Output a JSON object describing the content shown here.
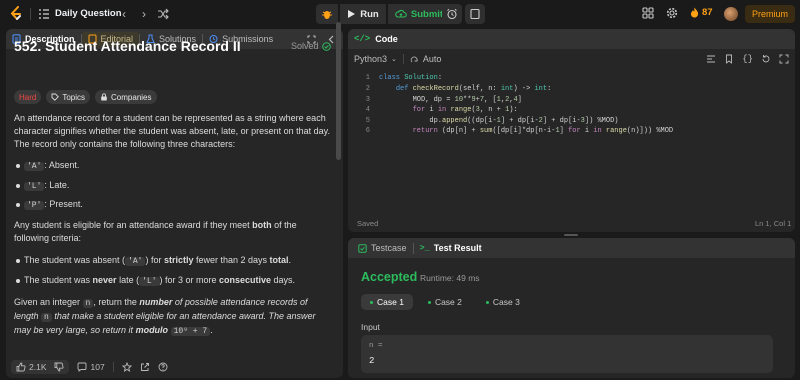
{
  "topbar": {
    "title": "Daily Question",
    "run_label": "Run",
    "submit_label": "Submit",
    "streak": "87",
    "premium": "Premium",
    "accent": "#ffa116",
    "submit_color": "#2cbb5d"
  },
  "left": {
    "tabs": [
      "Description",
      "Editorial",
      "Solutions",
      "Submissions"
    ],
    "title": "552. Student Attendance Record II",
    "solved": "Solved",
    "badges": {
      "difficulty": "Hard",
      "topics": "Topics",
      "companies": "Companies"
    },
    "difficulty_color": "#ef4743",
    "para1": "An attendance record for a student can be represented as a string where each character signifies whether the student was absent, late, or present on that day. The record only contains the following three characters:",
    "bullets": [
      {
        "code": "'A'",
        "text": ": Absent."
      },
      {
        "code": "'L'",
        "text": ": Late."
      },
      {
        "code": "'P'",
        "text": ": Present."
      }
    ],
    "para2": {
      "pre": "Any student is eligible for an attendance award if they meet ",
      "bold": "both",
      "post": " of the following criteria:"
    },
    "crit1": {
      "a": "The student was absent (",
      "code": "'A'",
      "b": ") for ",
      "s1": "strictly",
      "c": " fewer than 2 days ",
      "s2": "total",
      "d": "."
    },
    "crit2": {
      "a": "The student was ",
      "s1": "never",
      "b": " late (",
      "code": "'L'",
      "c": ") for 3 or more ",
      "s2": "consecutive",
      "d": " days."
    },
    "para3": {
      "a": "Given an integer ",
      "n": "n",
      "b": ", return the ",
      "number": "number",
      "c": " of possible attendance records of length ",
      "n2": "n",
      "d": " that make a student eligible for an attendance award. The answer may be very large, so return it ",
      "modulo": "modulo",
      "mod_val": "10⁹ + 7",
      "e": "."
    },
    "footer": {
      "likes": "2.1K",
      "comments": "107"
    }
  },
  "code": {
    "title": "Code",
    "language": "Python3",
    "autosave": "Auto",
    "lines": [
      "1",
      "2",
      "3",
      "4",
      "5",
      "6"
    ],
    "saved": "Saved",
    "cursor": "Ln 1, Col 1"
  },
  "result": {
    "tab_testcase": "Testcase",
    "tab_result": "Test Result",
    "verdict": "Accepted",
    "runtime": "Runtime: 49 ms",
    "cases": [
      "Case 1",
      "Case 2",
      "Case 3"
    ],
    "input_label": "Input",
    "input_name": "n =",
    "input_value": "2"
  }
}
